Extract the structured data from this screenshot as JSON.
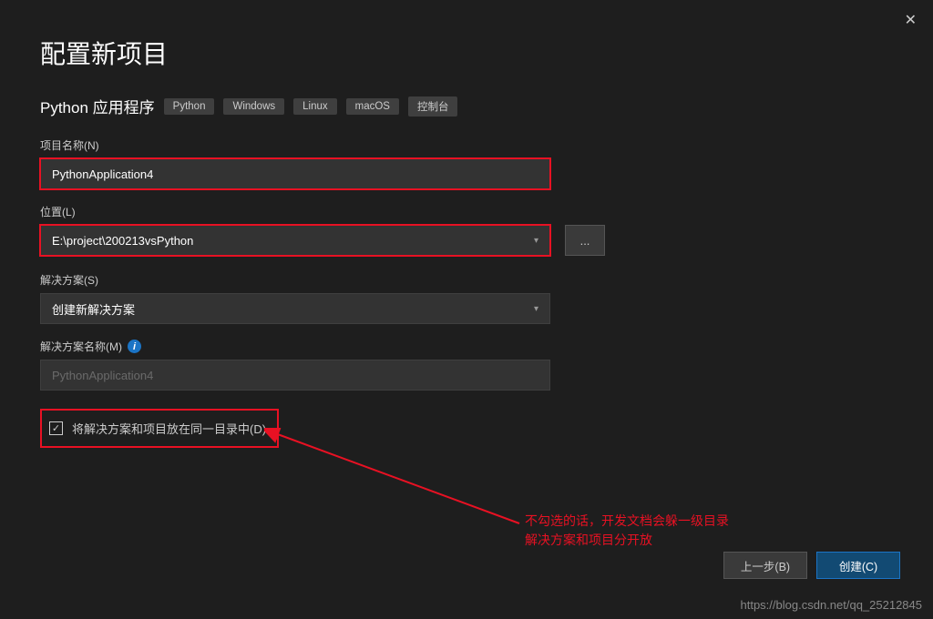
{
  "pageTitle": "配置新项目",
  "subtitle": "Python 应用程序",
  "tags": [
    "Python",
    "Windows",
    "Linux",
    "macOS",
    "控制台"
  ],
  "fields": {
    "projectName": {
      "label": "项目名称(N)",
      "value": "PythonApplication4"
    },
    "location": {
      "label": "位置(L)",
      "value": "E:\\project\\200213vsPython"
    },
    "solution": {
      "label": "解决方案(S)",
      "value": "创建新解决方案"
    },
    "solutionName": {
      "label": "解决方案名称(M)",
      "placeholder": "PythonApplication4"
    }
  },
  "browseBtn": "...",
  "checkbox": {
    "label": "将解决方案和项目放在同一目录中(D)",
    "checked": true
  },
  "annotation": {
    "line1": "不勾选的话，开发文档会躲一级目录",
    "line2": "解决方案和项目分开放"
  },
  "buttons": {
    "back": "上一步(B)",
    "create": "创建(C)"
  },
  "watermark": "https://blog.csdn.net/qq_25212845"
}
